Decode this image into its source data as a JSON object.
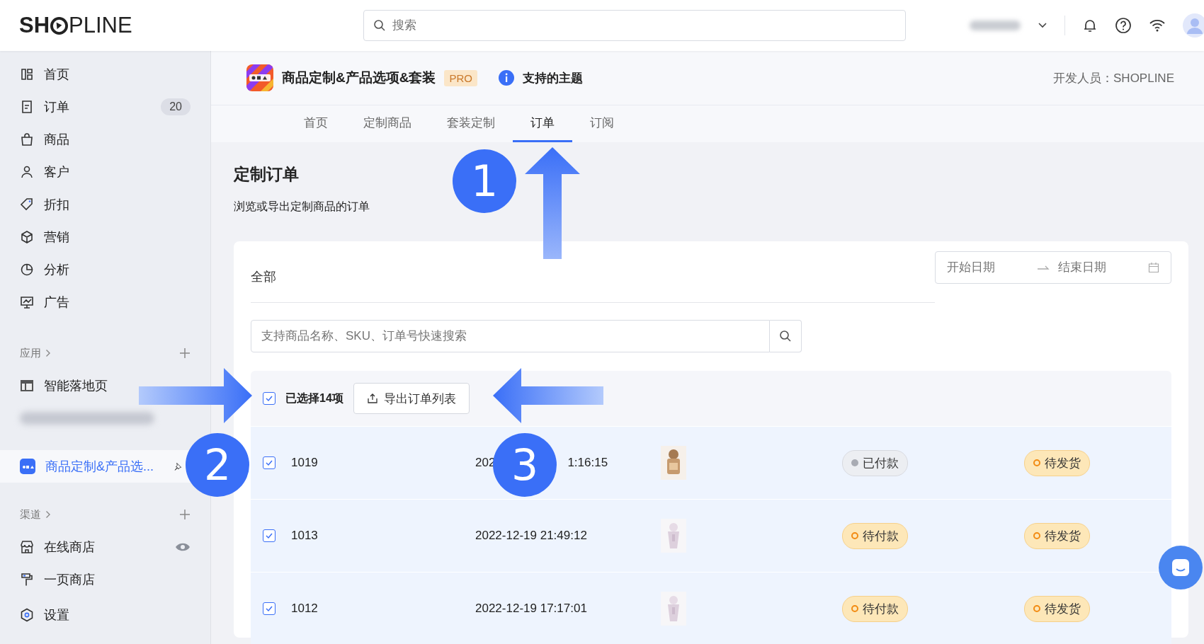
{
  "topbar": {
    "logo_parts": [
      "SH",
      "PLINE"
    ],
    "search": {
      "placeholder": "搜索"
    }
  },
  "sidebar": {
    "main_items": [
      {
        "label": "首页",
        "selected": false
      },
      {
        "label": "订单",
        "badge": "20",
        "selected": false
      },
      {
        "label": "商品",
        "selected": false
      },
      {
        "label": "客户",
        "selected": false
      },
      {
        "label": "折扣",
        "selected": false
      },
      {
        "label": "营销",
        "selected": false
      },
      {
        "label": "分析",
        "selected": false
      },
      {
        "label": "广告",
        "selected": false
      }
    ],
    "apps": {
      "heading": "应用",
      "items": [
        {
          "kind": "app",
          "label": "智能落地页",
          "selected": false
        },
        {
          "kind": "blurred",
          "selected": false
        },
        {
          "kind": "pinned",
          "label": "商品定制&产品选...",
          "selected": true
        }
      ]
    },
    "channels": {
      "heading": "渠道",
      "items": [
        {
          "kind": "store",
          "label": "在线商店",
          "selected": false
        },
        {
          "kind": "onepage",
          "label": "一页商店",
          "selected": false
        }
      ]
    },
    "settings": {
      "label": "设置",
      "selected": false
    }
  },
  "app_header": {
    "title": "商品定制&产品选项&套装",
    "plan": "PRO",
    "themes_link": "支持的主题",
    "developer": "开发人员：SHOPLINE"
  },
  "tabs": [
    {
      "label": "首页",
      "selected": false
    },
    {
      "label": "定制商品",
      "selected": false
    },
    {
      "label": "套装定制",
      "selected": false
    },
    {
      "label": "订单",
      "selected": true
    },
    {
      "label": "订阅",
      "selected": false
    }
  ],
  "page": {
    "title": "定制订单",
    "subtitle": "浏览或导出定制商品的订单"
  },
  "orders": {
    "filter_tab": "全部",
    "date_start": {
      "placeholder": "开始日期"
    },
    "date_end": {
      "placeholder": "结束日期"
    },
    "search": {
      "placeholder": "支持商品名称、SKU、订单号快速搜索"
    },
    "selection": {
      "checked": true,
      "label": "已选择14项",
      "export_button": "导出订单列表"
    },
    "rows": [
      {
        "checked": true,
        "id": "1019",
        "date_parts": [
          "202",
          "1:16:15"
        ],
        "payment": {
          "kind": "paid",
          "label": "已付款"
        },
        "shipping": {
          "kind": "pending",
          "label": "待发货"
        }
      },
      {
        "checked": true,
        "id": "1013",
        "date_parts": [
          "2022-12-19 21:49:12"
        ],
        "payment": {
          "kind": "pending",
          "label": "待付款"
        },
        "shipping": {
          "kind": "pending",
          "label": "待发货"
        }
      },
      {
        "checked": true,
        "id": "1012",
        "date_parts": [
          "2022-12-19 17:17:01"
        ],
        "payment": {
          "kind": "pending",
          "label": "待付款"
        },
        "shipping": {
          "kind": "pending",
          "label": "待发货"
        }
      }
    ]
  },
  "annotations": [
    {
      "number": "1"
    },
    {
      "number": "2"
    },
    {
      "number": "3"
    }
  ]
}
